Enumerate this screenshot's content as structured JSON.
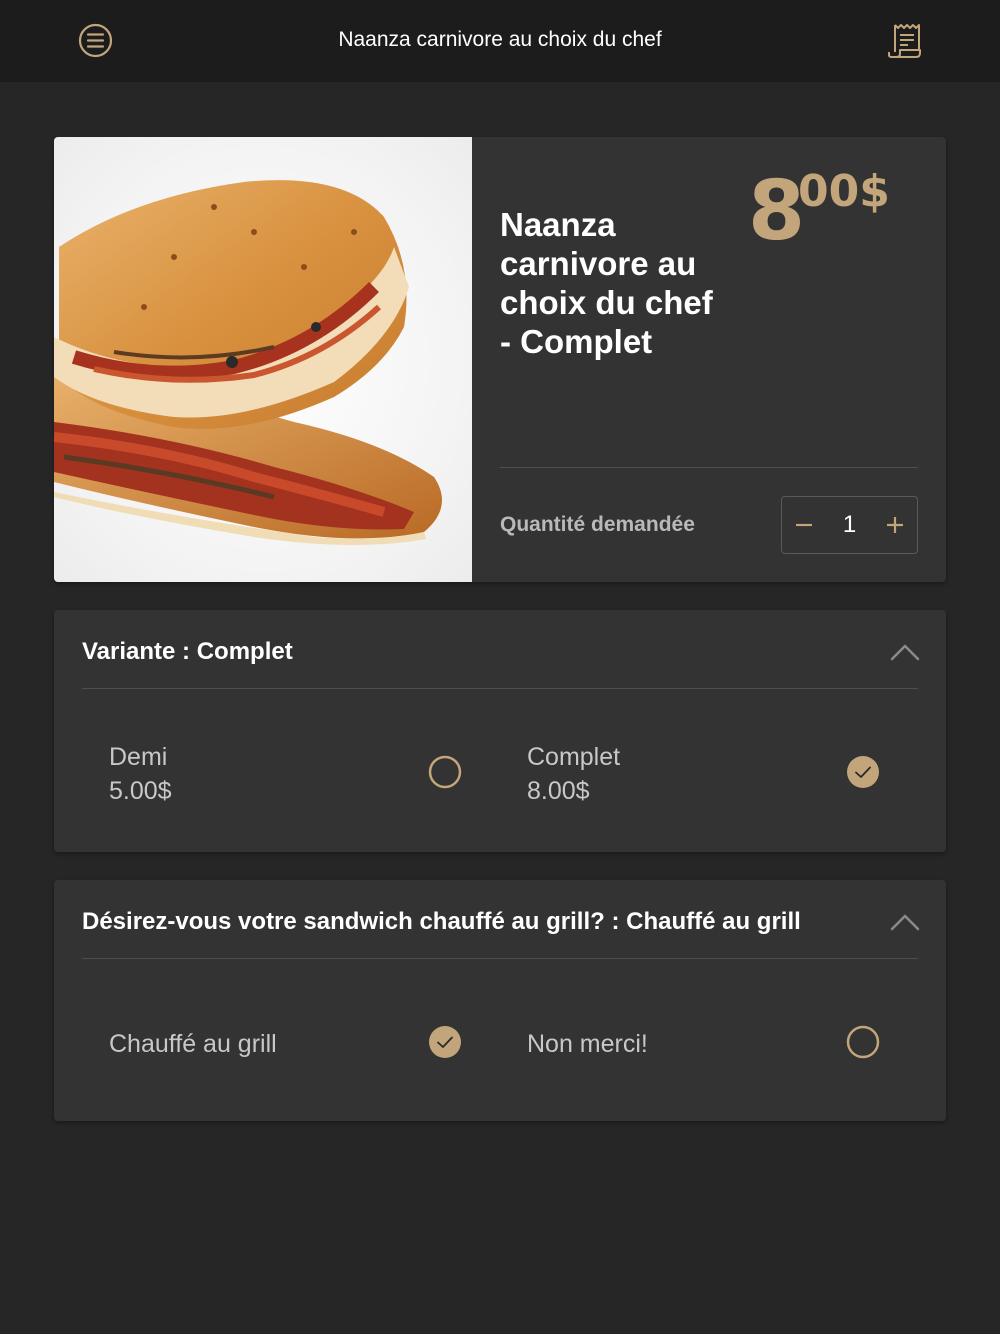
{
  "header": {
    "title": "Naanza carnivore au choix du chef",
    "menu_icon": "menu-icon",
    "receipt_icon": "receipt-icon"
  },
  "product": {
    "name": "Naanza carnivore au choix du chef - Complet",
    "price_integer": "8",
    "price_decimal": "00$",
    "quantity_label": "Quantité demandée",
    "quantity": "1"
  },
  "variant_section": {
    "title": "Variante : Complet",
    "options": [
      {
        "name": "Demi",
        "price": "5.00$",
        "selected": false
      },
      {
        "name": "Complet",
        "price": "8.00$",
        "selected": true
      }
    ]
  },
  "grill_section": {
    "title": "Désirez-vous votre sandwich chauffé au grill? : Chauffé au grill",
    "options": [
      {
        "name": "Chauffé au grill",
        "selected": true
      },
      {
        "name": "Non merci!",
        "selected": false
      }
    ]
  },
  "colors": {
    "accent": "#c2a57a",
    "background": "#262626",
    "card": "#333333",
    "header": "#1c1c1c"
  }
}
